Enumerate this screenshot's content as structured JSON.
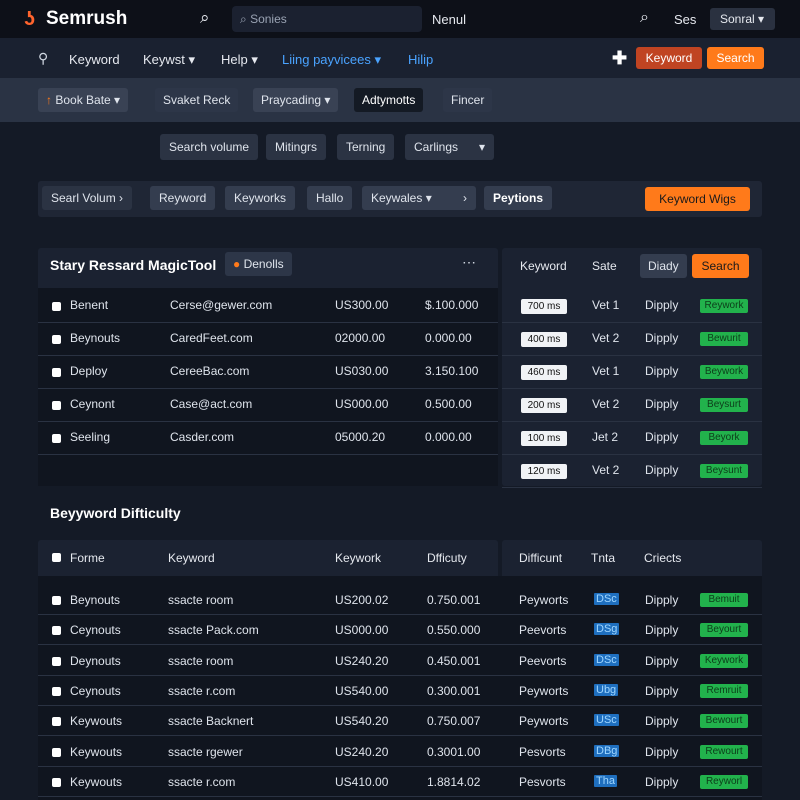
{
  "topbar": {
    "logo": "Semrush",
    "search_placeholder": "Sonies",
    "menu": "Nenul",
    "user": "Ses",
    "select": "Sonral"
  },
  "nav": {
    "items": [
      "Keyword",
      "Keywst",
      "Help",
      "Liing payvicees",
      "Hilip"
    ],
    "keyword_btn": "Keyword",
    "search_btn": "Search"
  },
  "subnav": {
    "book": "Book Bate",
    "items": [
      "Svaket Reck",
      "Praycading",
      "Adtymotts",
      "Fincer"
    ]
  },
  "filters": [
    "Search volume",
    "Mitingrs",
    "Terning",
    "Carlings"
  ],
  "toolbar": {
    "items": [
      "Searl Volum",
      "Reyword",
      "Keyworks",
      "Hallo",
      "Keywales",
      "Peytions"
    ],
    "action": "Keyword Wigs"
  },
  "panel1": {
    "title": "Stary Ressard MagicTool",
    "badge": "Denolls",
    "right_headers": [
      "Keyword",
      "Sate",
      "Diady"
    ],
    "search_btn": "Search",
    "rows": [
      {
        "name": "Benent",
        "email": "Cerse@gewer.com",
        "v1": "US300.00",
        "v2": "$.100.000"
      },
      {
        "name": "Beynouts",
        "email": "CaredFeet.com",
        "v1": "02000.00",
        "v2": "0.000.00"
      },
      {
        "name": "Deploy",
        "email": "CereeBac.com",
        "v1": "US030.00",
        "v2": "3.150.100"
      },
      {
        "name": "Ceynont",
        "email": "Case@act.com",
        "v1": "US000.00",
        "v2": "0.500.00"
      },
      {
        "name": "Seeling",
        "email": "Casder.com",
        "v1": "05000.20",
        "v2": "0.000.00"
      }
    ],
    "right_rows": [
      {
        "ms": "700 ms",
        "ver": "Vet 1",
        "dip": "Dipply",
        "tag": "Reywork"
      },
      {
        "ms": "400 ms",
        "ver": "Vet 2",
        "dip": "Dipply",
        "tag": "Bewurit"
      },
      {
        "ms": "460 ms",
        "ver": "Vet 1",
        "dip": "Dipply",
        "tag": "Beywork"
      },
      {
        "ms": "200 ms",
        "ver": "Vet 2",
        "dip": "Dipply",
        "tag": "Beysurt"
      },
      {
        "ms": "100 ms",
        "ver": "Jet 2",
        "dip": "Dipply",
        "tag": "Beyork"
      },
      {
        "ms": "120 ms",
        "ver": "Vet 2",
        "dip": "Dipply",
        "tag": "Beysunt"
      }
    ]
  },
  "panel2": {
    "title": "Beyyword Difticulty",
    "headers": [
      "Forme",
      "Keyword",
      "Keywork",
      "Dfficuty"
    ],
    "right_headers": [
      "Difficunt",
      "Tnta",
      "Criects"
    ],
    "rows": [
      {
        "name": "Beynouts",
        "kw": "ssacte room",
        "v1": "US200.02",
        "v2": "0.750.001",
        "p": "Peyworts",
        "t": "DSc",
        "dip": "Dipply",
        "tag": "Bemuit"
      },
      {
        "name": "Ceynouts",
        "kw": "ssacte Pack.com",
        "v1": "US000.00",
        "v2": "0.550.000",
        "p": "Peevorts",
        "t": "DSg",
        "dip": "Dipply",
        "tag": "Beyourt"
      },
      {
        "name": "Deynouts",
        "kw": "ssacte room",
        "v1": "US240.20",
        "v2": "0.450.001",
        "p": "Peevorts",
        "t": "DSc",
        "dip": "Dipply",
        "tag": "Keywork"
      },
      {
        "name": "Ceynouts",
        "kw": "ssacte r.com",
        "v1": "US540.00",
        "v2": "0.300.001",
        "p": "Peyworts",
        "t": "Ubg",
        "dip": "Dipply",
        "tag": "Remruit"
      },
      {
        "name": "Keywouts",
        "kw": "ssacte Backnert",
        "v1": "US540.20",
        "v2": "0.750.007",
        "p": "Peyworts",
        "t": "USc",
        "dip": "Dipply",
        "tag": "Bewourt"
      },
      {
        "name": "Keywouts",
        "kw": "ssacte rgewer",
        "v1": "US240.20",
        "v2": "0.3001.00",
        "p": "Pesvorts",
        "t": "DBg",
        "dip": "Dipply",
        "tag": "Rewourt"
      },
      {
        "name": "Keywouts",
        "kw": "ssacte r.com",
        "v1": "US410.00",
        "v2": "1.8814.02",
        "p": "Pesvorts",
        "t": "Tha",
        "dip": "Dipply",
        "tag": "Reyworl"
      }
    ]
  }
}
